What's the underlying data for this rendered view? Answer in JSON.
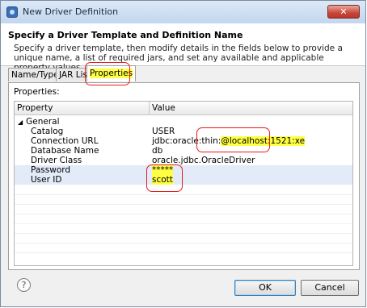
{
  "window": {
    "title": "New Driver Definition",
    "close_label": "✕"
  },
  "header": {
    "title": "Specify a Driver Template and Definition Name",
    "description": "Specify a driver template, then modify details in the fields below to provide a unique name, a list of required jars, and set any available and applicable property values."
  },
  "tabs": [
    {
      "label": "Name/Type",
      "selected": false
    },
    {
      "label": "JAR List",
      "selected": false
    },
    {
      "label": "Properties",
      "selected": true
    }
  ],
  "panel": {
    "label": "Properties:"
  },
  "table": {
    "columns": [
      "Property",
      "Value"
    ],
    "group": "General",
    "expander": "◢",
    "rows": [
      {
        "property": "Catalog",
        "value": "USER"
      },
      {
        "property": "Connection URL",
        "value_prefix": "jdbc:oracle:thin:",
        "value_highlight": "@localhost:1521:xe"
      },
      {
        "property": "Database Name",
        "value": "db"
      },
      {
        "property": "Driver Class",
        "value": "oracle.jdbc.OracleDriver"
      },
      {
        "property": "Password",
        "value": "*****"
      },
      {
        "property": "User ID",
        "value": "scott"
      }
    ]
  },
  "buttons": {
    "help": "?",
    "ok": "OK",
    "cancel": "Cancel"
  },
  "colors": {
    "highlight": "#ffff44",
    "annotation": "#e51c1c",
    "selection": "#e2ebf7"
  }
}
